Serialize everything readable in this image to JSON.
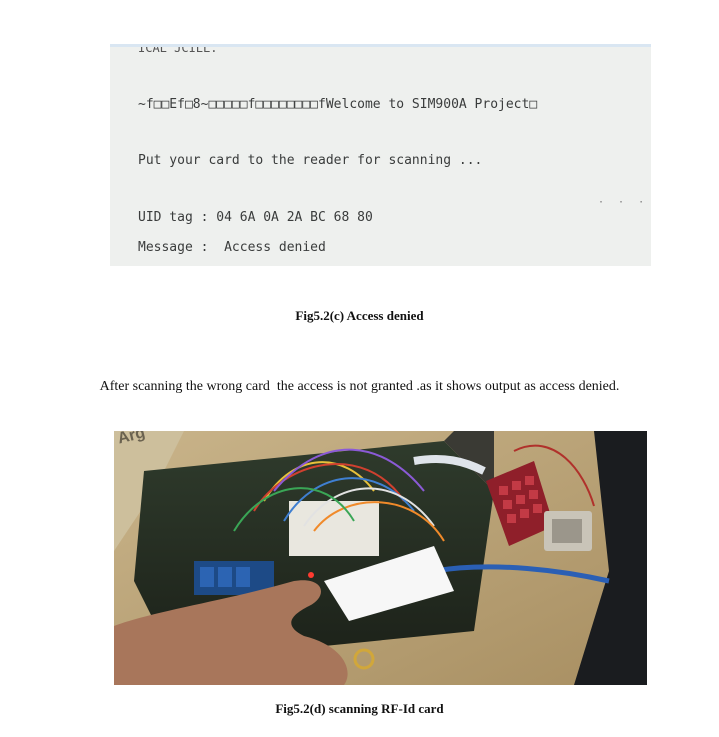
{
  "serial_monitor": {
    "cut_line": "ICAL JCILL.",
    "garbled_prefix": "~f\u0002□\u0002□E\u0002f□8~□□□□□f□□□□□□□□f\u0002",
    "welcome": "Welcome to SIM900A Project□",
    "put_card": "Put your card to the reader for scanning ...",
    "uid_line": "UID tag : 04 6A 0A 2A BC 68 80",
    "message_line": "Message :  Access denied"
  },
  "figure_c": {
    "caption": "Fig5.2(c) Access denied"
  },
  "paragraph": "After scanning the wrong card  the access is not granted .as it shows output as access denied.",
  "figure_d": {
    "caption": "Fig5.2(d) scanning RF-Id card",
    "box_brand": "Arg"
  }
}
